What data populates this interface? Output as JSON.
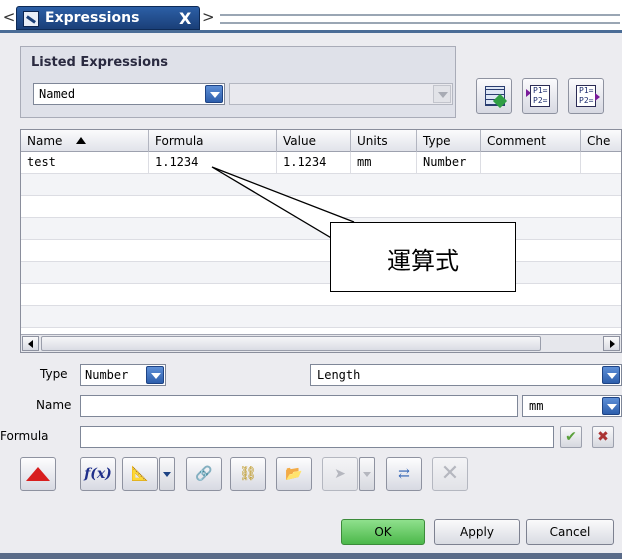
{
  "window": {
    "title": "Expressions",
    "close_glyph": "X",
    "prev_glyph": "<",
    "next_glyph": ">"
  },
  "listed": {
    "title": "Listed Expressions",
    "filter_value": "Named",
    "secondary_value": "",
    "tools": [
      "spreadsheet-edit-icon",
      "import-expressions-icon",
      "export-expressions-icon"
    ],
    "p1": "P1=",
    "p2": "P2="
  },
  "table": {
    "columns": [
      "Name",
      "Formula",
      "Value",
      "Units",
      "Type",
      "Comment",
      "Che"
    ],
    "rows": [
      {
        "name": "test",
        "formula": "1.1234",
        "value": "1.1234",
        "units": "mm",
        "type": "Number",
        "comment": "",
        "check": ""
      }
    ]
  },
  "annotation": {
    "text": "運算式"
  },
  "properties": {
    "type_label": "Type",
    "type_value": "Number",
    "dimension_value": "Length",
    "name_label": "Name",
    "name_value": "",
    "units_value": "mm",
    "formula_label": "Formula",
    "formula_value": "",
    "fx_label": "f(x)"
  },
  "buttons": {
    "ok": "OK",
    "apply": "Apply",
    "cancel": "Cancel"
  },
  "colors": {
    "tab_blue": "#2c5fa6",
    "ok_green": "#4cb84a",
    "up_arrow_red": "#d81e1e"
  }
}
